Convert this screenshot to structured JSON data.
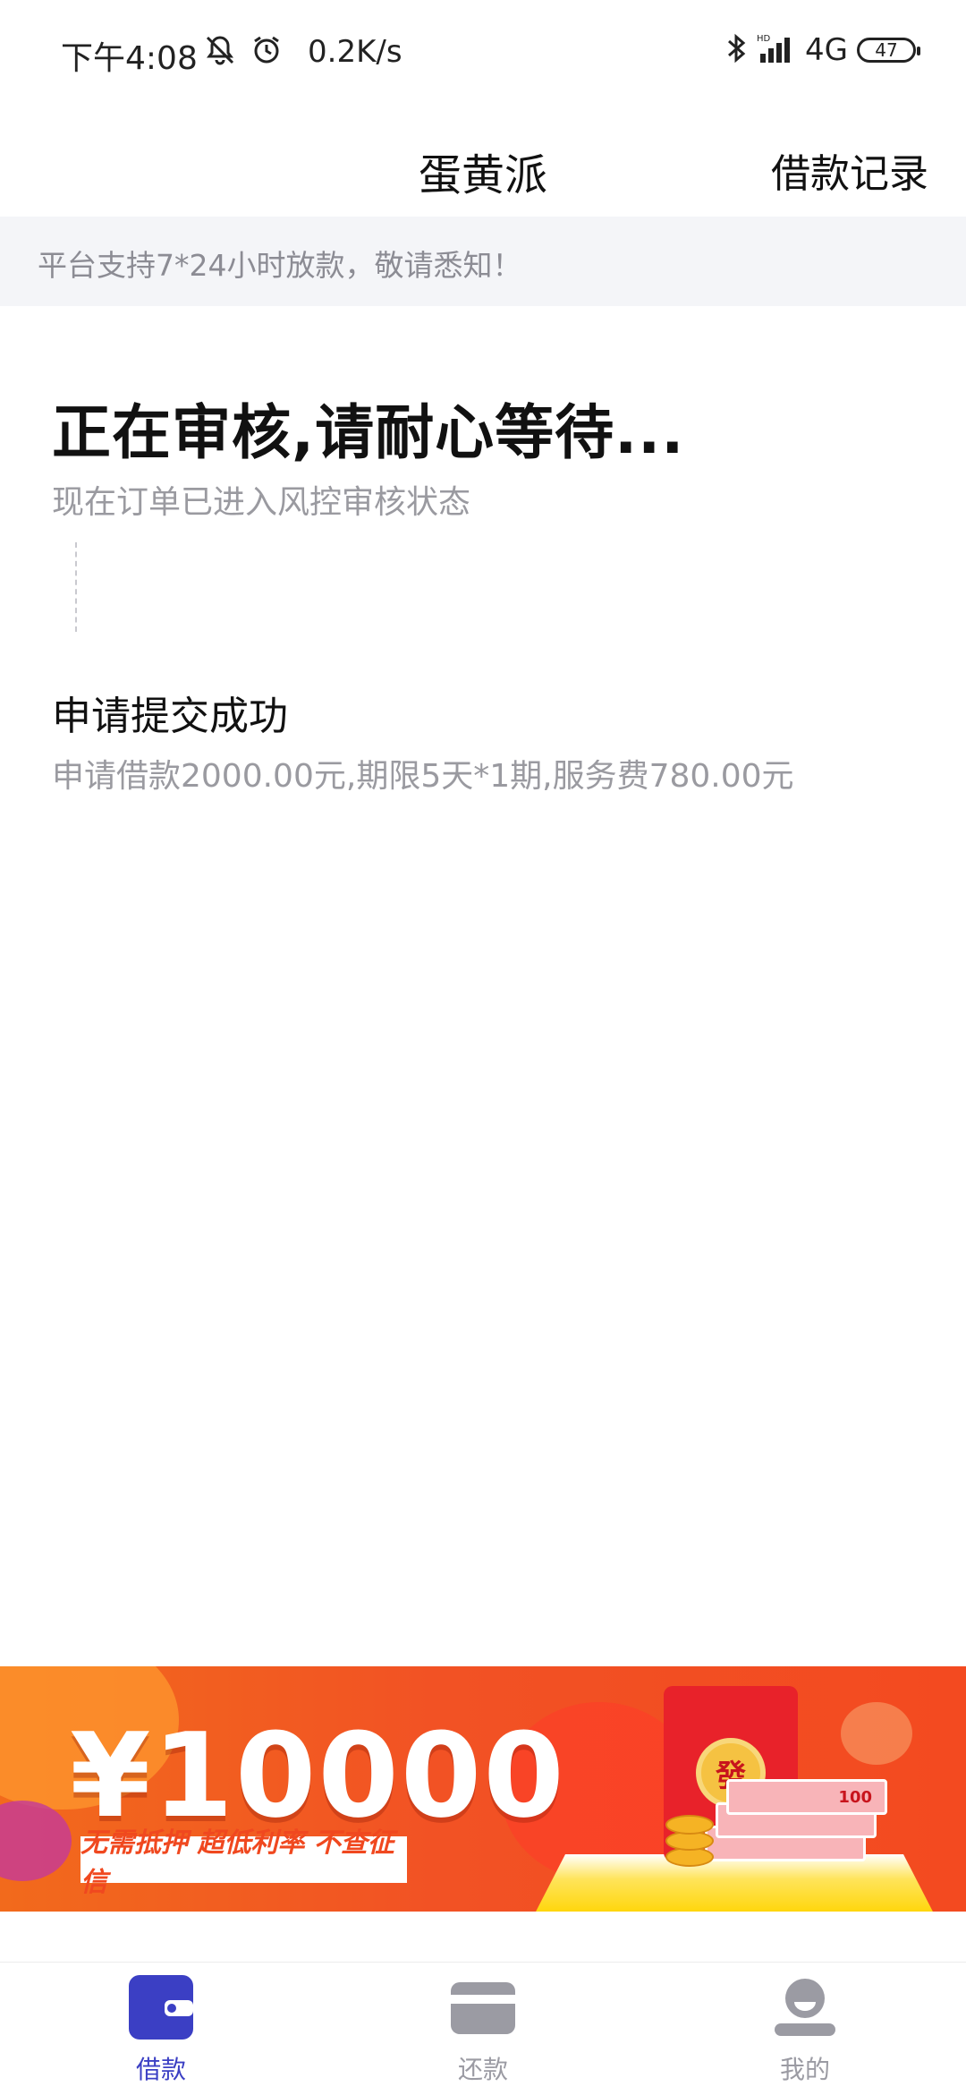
{
  "status_bar": {
    "time": "下午4:08",
    "speed": "0.2K/s",
    "network": "4G",
    "battery": "47",
    "icons": [
      "mute-icon",
      "alarm-icon",
      "bluetooth-icon",
      "signal-icon"
    ]
  },
  "header": {
    "title": "蛋黄派",
    "action": "借款记录"
  },
  "notice": "平台支持7*24小时放款，敬请悉知！",
  "review": {
    "title": "正在审核,请耐心等待...",
    "subtitle": "现在订单已进入风控审核状态"
  },
  "step": {
    "title": "申请提交成功",
    "desc": "申请借款2000.00元,期限5天*1期,服务费780.00元"
  },
  "banner": {
    "amount": "¥10000",
    "tagline": "无需抵押 超低利率 不查征信",
    "seal_char": "發",
    "bill_value": "100"
  },
  "tabs": [
    {
      "label": "借款",
      "icon": "wallet-icon",
      "active": true
    },
    {
      "label": "还款",
      "icon": "card-icon",
      "active": false
    },
    {
      "label": "我的",
      "icon": "user-icon",
      "active": false
    }
  ],
  "colors": {
    "accent": "#3b3fc4",
    "inactive": "#9b9ba3",
    "banner": "#f25224"
  }
}
